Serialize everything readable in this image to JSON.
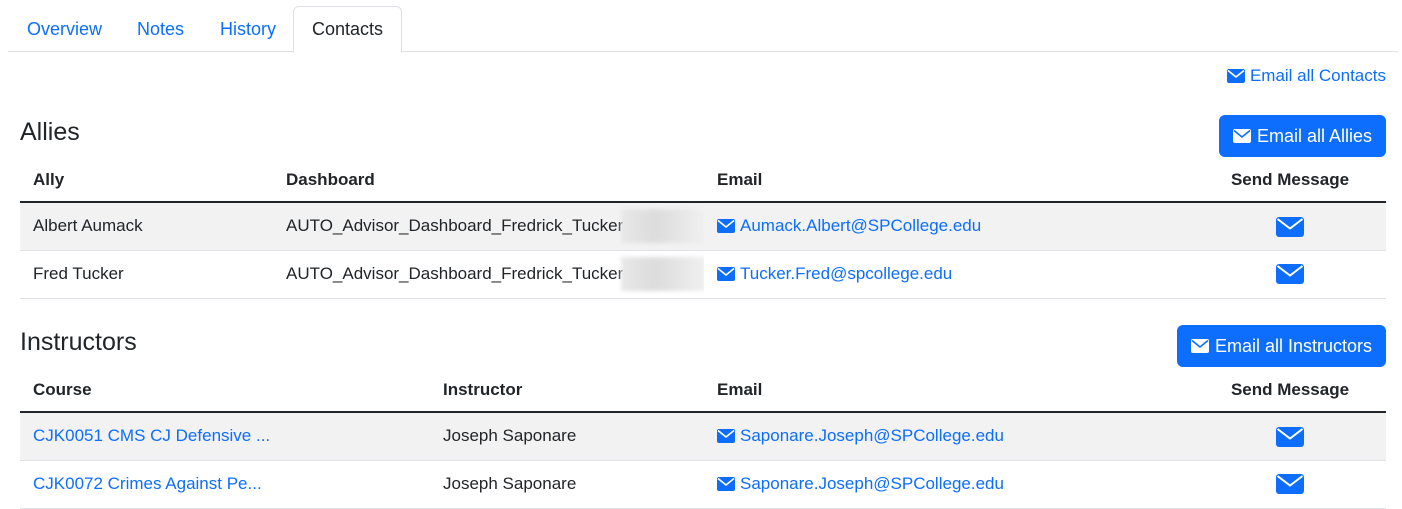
{
  "tabs": [
    {
      "label": "Overview"
    },
    {
      "label": "Notes"
    },
    {
      "label": "History"
    },
    {
      "label": "Contacts"
    }
  ],
  "active_tab": "Contacts",
  "email_all_contacts_label": "Email all Contacts",
  "allies": {
    "title": "Allies",
    "button_label": "Email all Allies",
    "columns": [
      "Ally",
      "Dashboard",
      "Email",
      "Send Message"
    ],
    "rows": [
      {
        "ally": "Albert Aumack",
        "dashboard": "AUTO_Advisor_Dashboard_Fredrick_Tucker",
        "email": "Aumack.Albert@SPCollege.edu"
      },
      {
        "ally": "Fred Tucker",
        "dashboard": "AUTO_Advisor_Dashboard_Fredrick_Tucker",
        "email": "Tucker.Fred@spcollege.edu"
      }
    ]
  },
  "instructors": {
    "title": "Instructors",
    "button_label": "Email all Instructors",
    "columns": [
      "Course",
      "Instructor",
      "Email",
      "Send Message"
    ],
    "rows": [
      {
        "course": "CJK0051 CMS CJ Defensive ...",
        "instructor": "Joseph Saponare",
        "email": "Saponare.Joseph@SPCollege.edu"
      },
      {
        "course": "CJK0072 Crimes Against Pe...",
        "instructor": "Joseph Saponare",
        "email": "Saponare.Joseph@SPCollege.edu"
      }
    ]
  },
  "icons": {
    "envelope": "envelope-icon"
  },
  "colors": {
    "accent": "#0d6efd",
    "text": "#212529",
    "stripe": "#f2f2f2"
  }
}
